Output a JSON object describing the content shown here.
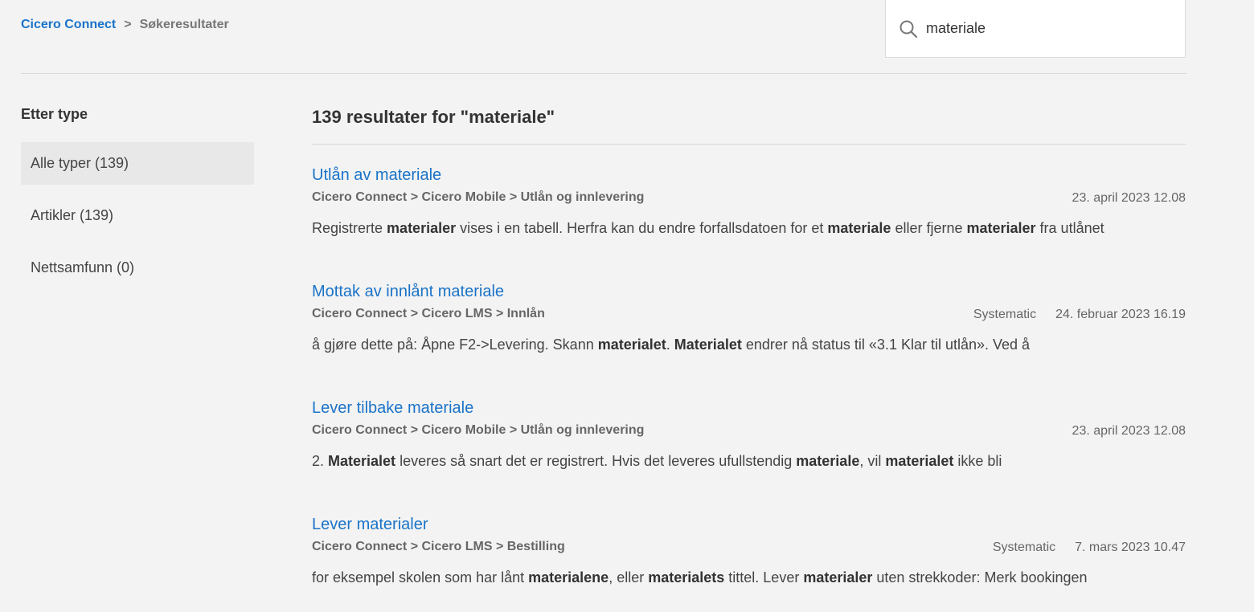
{
  "breadcrumb": {
    "home": "Cicero Connect",
    "separator": ">",
    "current": "Søkeresultater"
  },
  "search": {
    "value": "materiale",
    "icon": "search-icon"
  },
  "sidebar": {
    "title": "Etter type",
    "filters": [
      {
        "label": "Alle typer (139)",
        "active": true
      },
      {
        "label": "Artikler (139)",
        "active": false
      },
      {
        "label": "Nettsamfunn (0)",
        "active": false
      }
    ]
  },
  "results_heading": "139 resultater for \"materiale\"",
  "results": [
    {
      "title": "Utlån av materiale",
      "path": "Cicero Connect > Cicero Mobile > Utlån og innlevering",
      "author": "",
      "date": "23. april 2023 12.08",
      "snippet": [
        {
          "t": "Registrerte ",
          "b": false
        },
        {
          "t": "materialer",
          "b": true
        },
        {
          "t": " vises i en tabell. Herfra kan du endre forfallsdatoen for et ",
          "b": false
        },
        {
          "t": "materiale",
          "b": true
        },
        {
          "t": " eller fjerne ",
          "b": false
        },
        {
          "t": "materialer",
          "b": true
        },
        {
          "t": " fra utlånet",
          "b": false
        }
      ]
    },
    {
      "title": "Mottak av innlånt materiale",
      "path": "Cicero Connect > Cicero LMS > Innlån",
      "author": "Systematic",
      "date": "24. februar 2023 16.19",
      "snippet": [
        {
          "t": "å gjøre dette på: Åpne F2->Levering. Skann ",
          "b": false
        },
        {
          "t": "materialet",
          "b": true
        },
        {
          "t": ". ",
          "b": false
        },
        {
          "t": "Materialet",
          "b": true
        },
        {
          "t": " endrer nå status til «3.1 Klar til utlån». Ved å",
          "b": false
        }
      ]
    },
    {
      "title": "Lever tilbake materiale",
      "path": "Cicero Connect > Cicero Mobile > Utlån og innlevering",
      "author": "",
      "date": "23. april 2023 12.08",
      "snippet": [
        {
          "t": "2. ",
          "b": false
        },
        {
          "t": "Materialet",
          "b": true
        },
        {
          "t": " leveres så snart det er registrert. Hvis det leveres ufullstendig ",
          "b": false
        },
        {
          "t": "materiale",
          "b": true
        },
        {
          "t": ", vil ",
          "b": false
        },
        {
          "t": "materialet",
          "b": true
        },
        {
          "t": " ikke bli",
          "b": false
        }
      ]
    },
    {
      "title": "Lever materialer",
      "path": "Cicero Connect > Cicero LMS > Bestilling",
      "author": "Systematic",
      "date": "7. mars 2023 10.47",
      "snippet": [
        {
          "t": "for eksempel skolen som har lånt ",
          "b": false
        },
        {
          "t": "materialene",
          "b": true
        },
        {
          "t": ", eller ",
          "b": false
        },
        {
          "t": "materialets",
          "b": true
        },
        {
          "t": " tittel. Lever ",
          "b": false
        },
        {
          "t": "materialer",
          "b": true
        },
        {
          "t": " uten strekkoder: Merk bookingen",
          "b": false
        }
      ]
    }
  ]
}
